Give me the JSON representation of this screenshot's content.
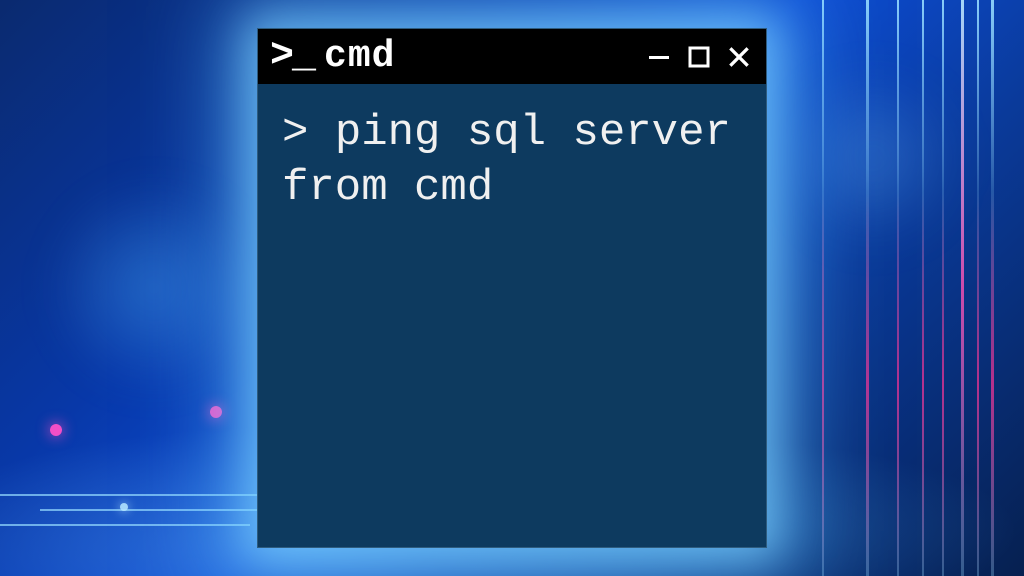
{
  "window": {
    "prompt_icon": ">_",
    "title": "cmd",
    "controls": {
      "minimize": "–",
      "maximize": "□",
      "close": "×"
    }
  },
  "terminal": {
    "prompt": ">",
    "command": "ping sql server from cmd"
  }
}
